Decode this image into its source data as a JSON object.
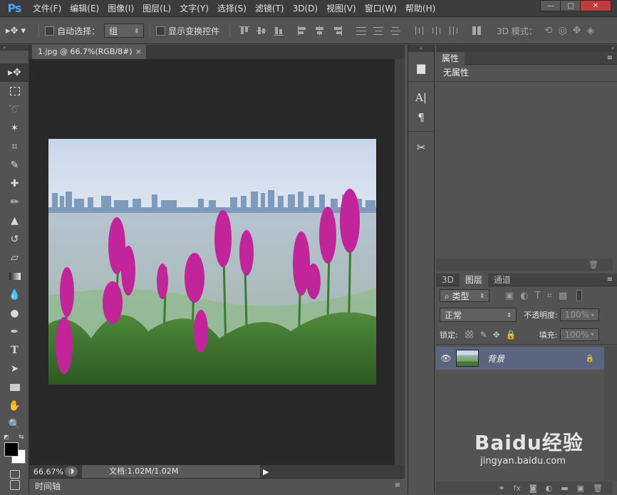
{
  "app": {
    "logo": "Ps"
  },
  "menu": [
    "文件(F)",
    "编辑(E)",
    "图像(I)",
    "图层(L)",
    "文字(Y)",
    "选择(S)",
    "滤镜(T)",
    "3D(D)",
    "视图(V)",
    "窗口(W)",
    "帮助(H)"
  ],
  "window_controls": {
    "minimize": "—",
    "maximize": "□",
    "close": "✕"
  },
  "options": {
    "auto_select_label": "自动选择：",
    "auto_select_value": "组",
    "show_transform_label": "显示变换控件",
    "mode3d_label": "3D 模式："
  },
  "document": {
    "tab_title": "1.jpg @ 66.7%(RGB/8#)",
    "tab_close": "×",
    "zoom": "66.67%",
    "doc_size": "文档:1.02M/1.02M"
  },
  "timeline": {
    "label": "时间轴"
  },
  "properties": {
    "tab": "属性",
    "body": "无属性"
  },
  "layers": {
    "tabs": [
      "3D",
      "图层",
      "通道"
    ],
    "active_tab": 1,
    "filter_label": "类型",
    "blend_mode": "正常",
    "opacity_label": "不透明度:",
    "opacity_value": "100%",
    "lock_label": "锁定:",
    "fill_label": "填充:",
    "fill_value": "100%",
    "layer_name": "背景"
  },
  "watermark": {
    "brand": "Baidu经验",
    "url": "jingyan.baidu.com"
  },
  "colors": {
    "accent": "#4ea3ff",
    "selected_layer": "#5a6680",
    "canvas_bg": "#282828"
  }
}
